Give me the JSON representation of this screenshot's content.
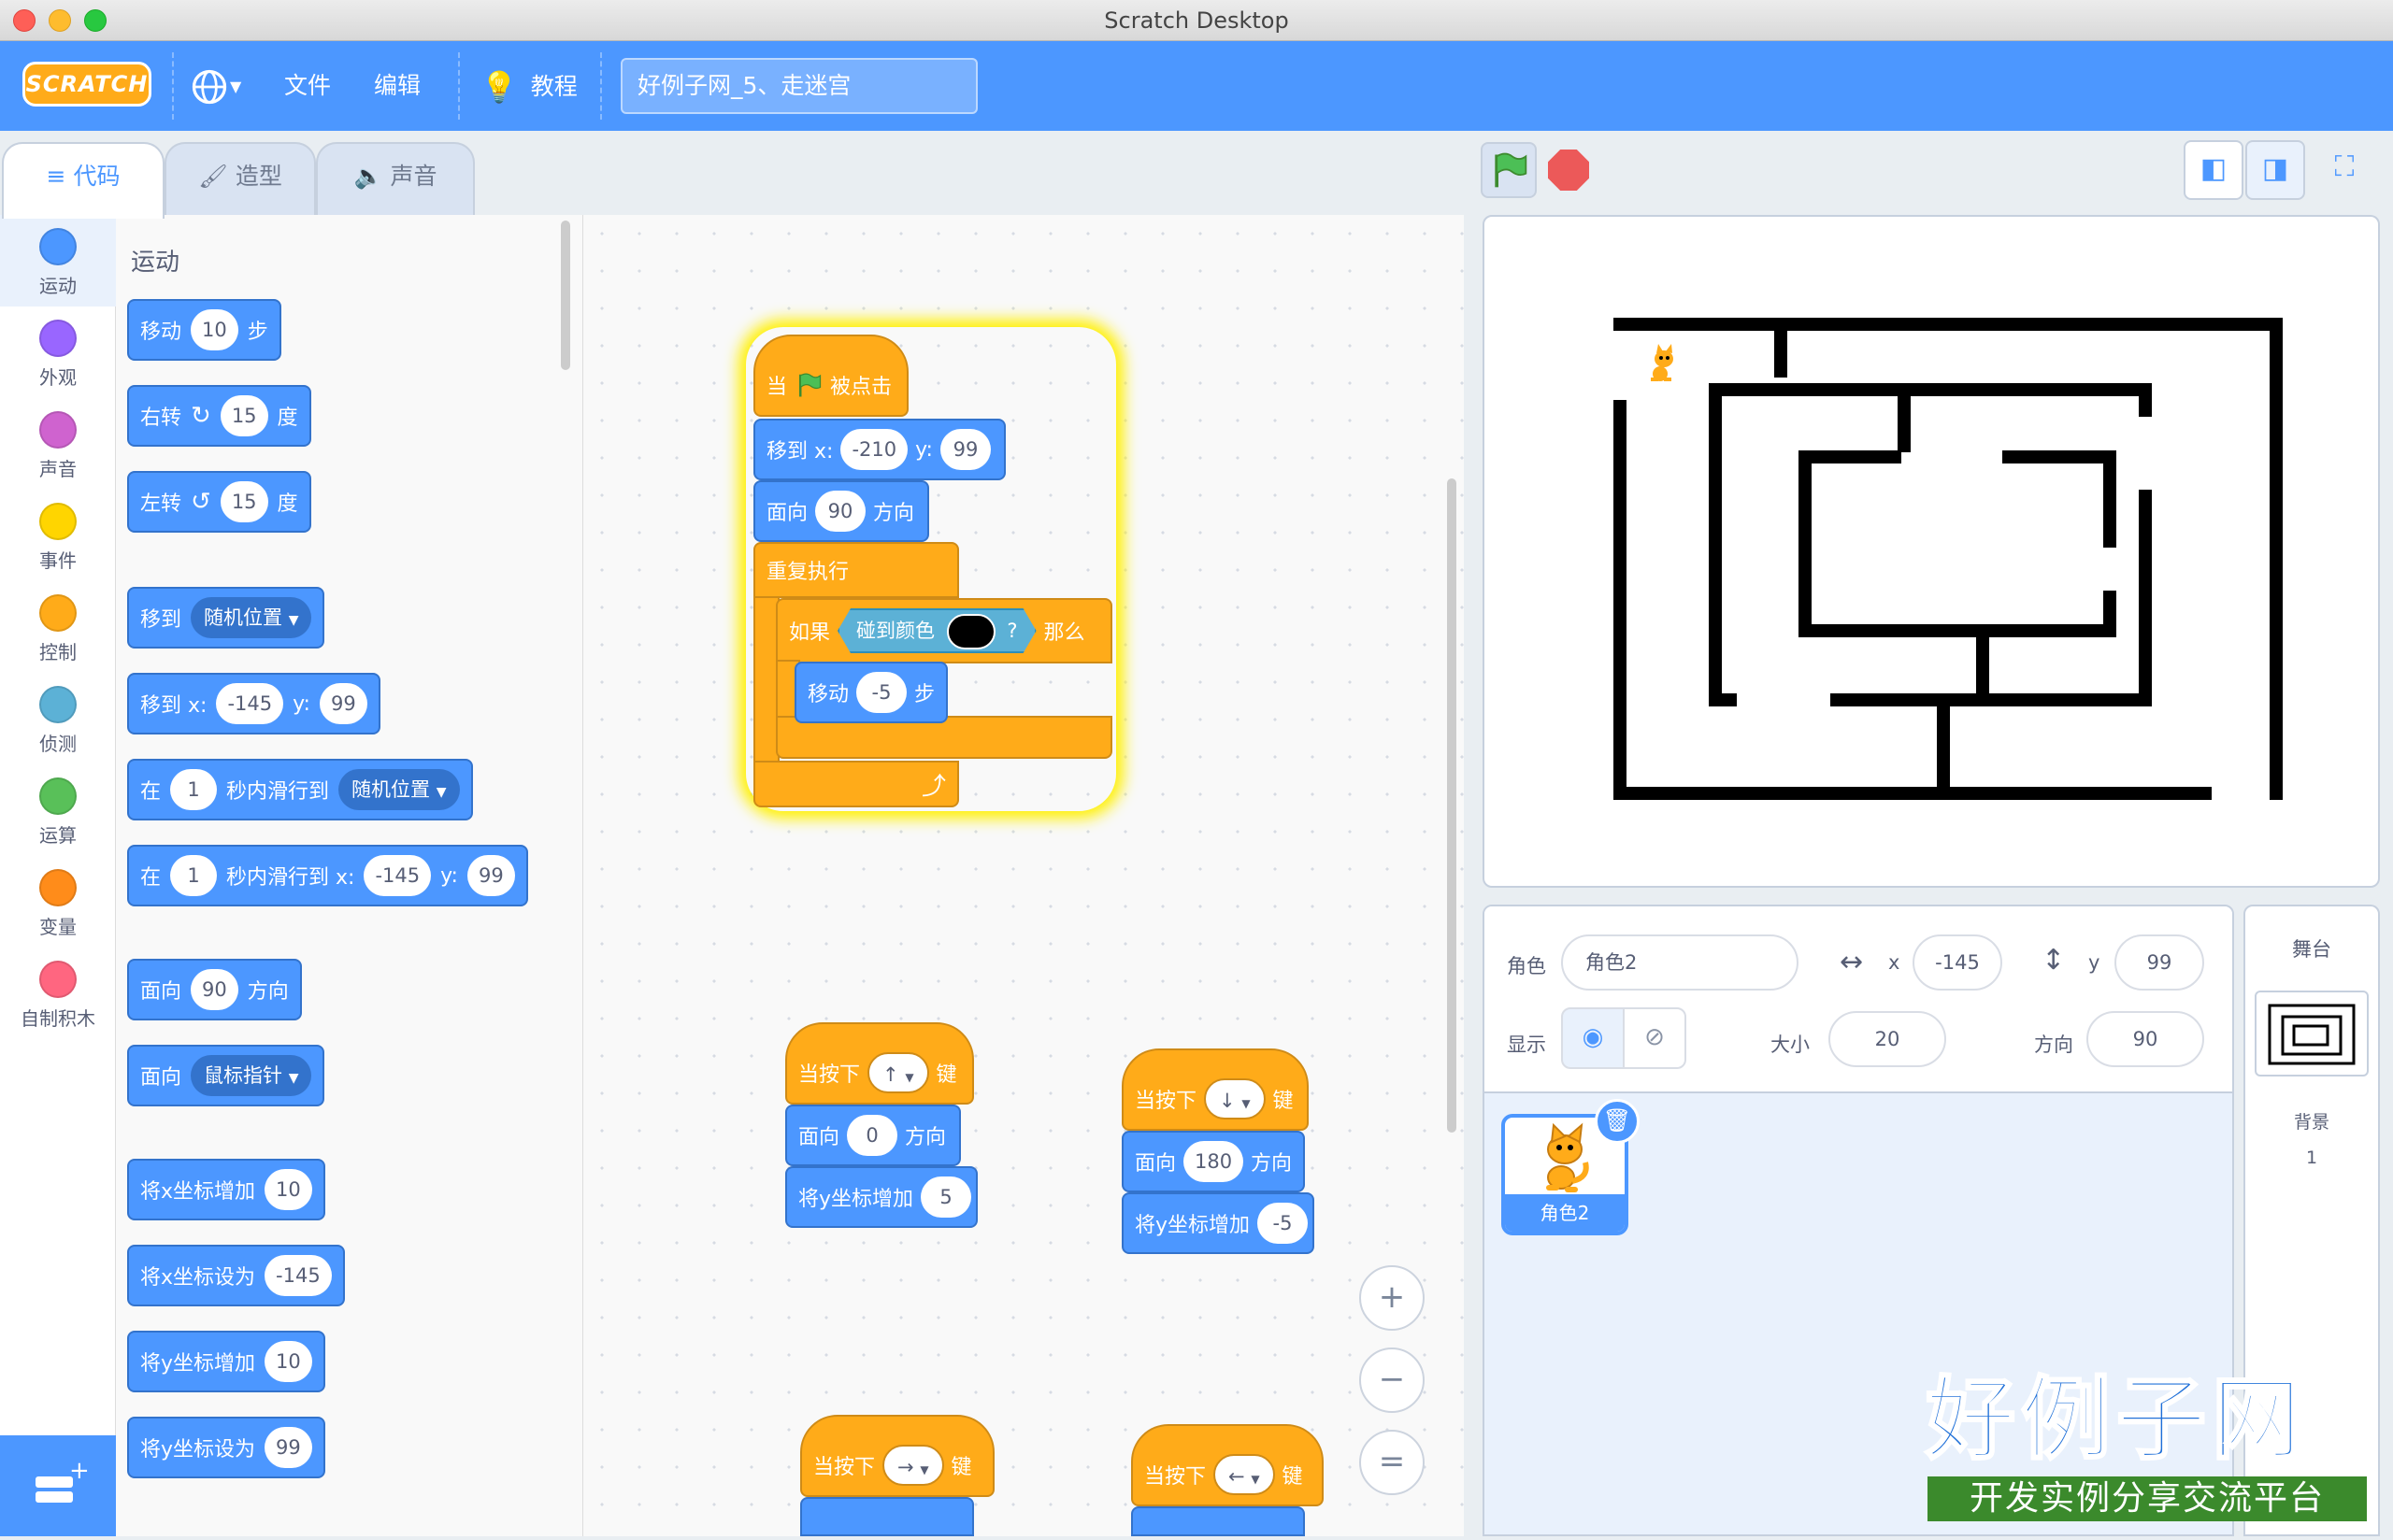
{
  "window": {
    "title": "Scratch Desktop"
  },
  "menubar": {
    "logo": "SCRATCH",
    "file": "文件",
    "edit": "编辑",
    "tutorials": "教程",
    "project_title": "好例子网_5、走迷宫"
  },
  "tabs": {
    "code": "代码",
    "costumes": "造型",
    "sounds": "声音"
  },
  "categories": [
    {
      "label": "运动",
      "color": "#4c97ff"
    },
    {
      "label": "外观",
      "color": "#9966ff"
    },
    {
      "label": "声音",
      "color": "#cf63cf"
    },
    {
      "label": "事件",
      "color": "#ffd500"
    },
    {
      "label": "控制",
      "color": "#ffab19"
    },
    {
      "label": "侦测",
      "color": "#5cb1d6"
    },
    {
      "label": "运算",
      "color": "#59c059"
    },
    {
      "label": "变量",
      "color": "#ff8c1a"
    },
    {
      "label": "自制积木",
      "color": "#ff6680"
    }
  ],
  "palette": {
    "heading": "运动",
    "move": {
      "a": "移动",
      "v": "10",
      "b": "步"
    },
    "turn_right": {
      "a": "右转",
      "v": "15",
      "b": "度"
    },
    "turn_left": {
      "a": "左转",
      "v": "15",
      "b": "度"
    },
    "goto": {
      "a": "移到",
      "dd": "随机位置"
    },
    "goto_xy": {
      "a": "移到 x:",
      "x": "-145",
      "b": "y:",
      "y": "99"
    },
    "glide": {
      "a": "在",
      "v": "1",
      "b": "秒内滑行到",
      "dd": "随机位置"
    },
    "glide_xy": {
      "a": "在",
      "v": "1",
      "b": "秒内滑行到 x:",
      "x": "-145",
      "c": "y:",
      "y": "99"
    },
    "point_dir": {
      "a": "面向",
      "v": "90",
      "b": "方向"
    },
    "point_towards": {
      "a": "面向",
      "dd": "鼠标指针"
    },
    "change_x": {
      "a": "将x坐标增加",
      "v": "10"
    },
    "set_x": {
      "a": "将x坐标设为",
      "v": "-145"
    },
    "change_y": {
      "a": "将y坐标增加",
      "v": "10"
    },
    "set_y": {
      "a": "将y坐标设为",
      "v": "99"
    }
  },
  "script": {
    "main": {
      "hat_a": "当",
      "hat_b": "被点击",
      "goto_a": "移到 x:",
      "goto_x": "-210",
      "goto_b": "y:",
      "goto_y": "99",
      "dir_a": "面向",
      "dir_v": "90",
      "dir_b": "方向",
      "forever": "重复执行",
      "if_a": "如果",
      "touch": "碰到颜色",
      "q": "?",
      "if_b": "那么",
      "mv_a": "移动",
      "mv_v": "-5",
      "mv_b": "步"
    },
    "up": {
      "a": "当按下",
      "key": "↑",
      "b": "键",
      "dir_a": "面向",
      "dir_v": "0",
      "dir_b": "方向",
      "ch": "将y坐标增加",
      "ch_v": "5"
    },
    "down": {
      "a": "当按下",
      "key": "↓",
      "b": "键",
      "dir_a": "面向",
      "dir_v": "180",
      "dir_b": "方向",
      "ch": "将y坐标增加",
      "ch_v": "-5"
    },
    "right": {
      "a": "当按下",
      "key": "→",
      "b": "键"
    },
    "left": {
      "a": "当按下",
      "key": "←",
      "b": "键"
    }
  },
  "zoom": {
    "in": "+",
    "out": "−",
    "reset": "="
  },
  "sprite_info": {
    "sprite_label": "角色",
    "sprite_name": "角色2",
    "x_label": "x",
    "x": "-145",
    "y_label": "y",
    "y": "99",
    "show_label": "显示",
    "size_label": "大小",
    "size": "20",
    "direction_label": "方向",
    "direction": "90"
  },
  "sprites": [
    {
      "name": "角色2"
    }
  ],
  "stage_panel": {
    "title": "舞台",
    "backdrops_label": "背景",
    "backdrops_count": "1"
  },
  "watermark": {
    "title": "好例子网",
    "subtitle": "开发实例分享交流平台"
  },
  "colors": {
    "menubar": "#4c97ff",
    "motion": "#4c97ff",
    "control": "#ffab19",
    "maze": "#000000"
  }
}
